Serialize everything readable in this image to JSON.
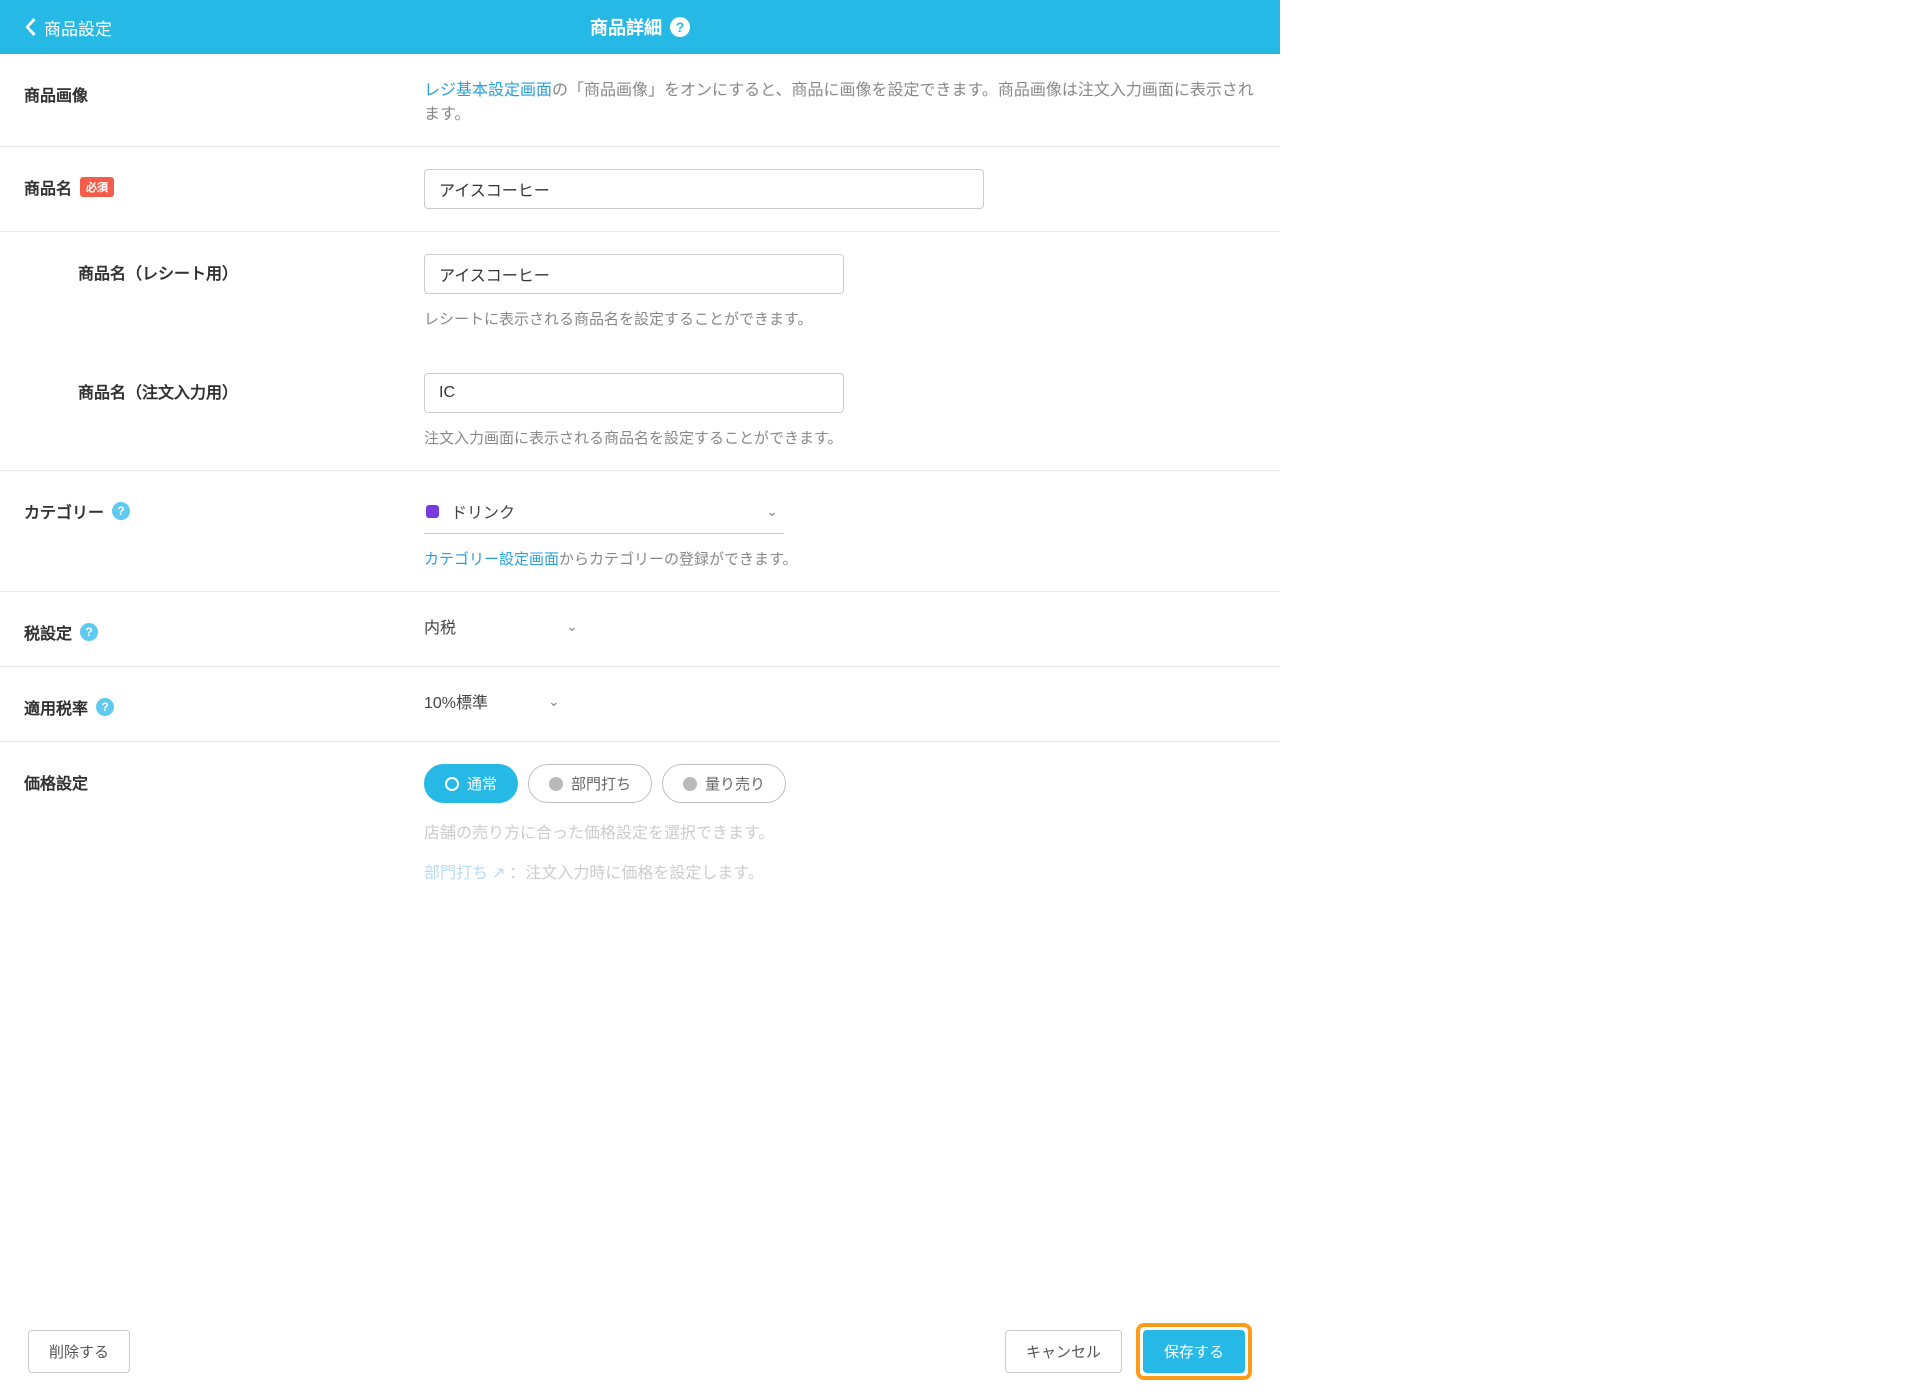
{
  "header": {
    "back_label": "商品設定",
    "title": "商品詳細",
    "help_glyph": "?"
  },
  "image_row": {
    "label": "商品画像",
    "link_text": "レジ基本設定画面",
    "desc_rest": "の「商品画像」をオンにすると、商品に画像を設定できます。商品画像は注文入力画面に表示されます。"
  },
  "name_row": {
    "label": "商品名",
    "required_badge": "必須",
    "value": "アイスコーヒー"
  },
  "receipt_row": {
    "label": "商品名（レシート用）",
    "value": "アイスコーヒー",
    "hint": "レシートに表示される商品名を設定することができます。"
  },
  "order_row": {
    "label": "商品名（注文入力用）",
    "value": "IC",
    "hint": "注文入力画面に表示される商品名を設定することができます。"
  },
  "category_row": {
    "label": "カテゴリー",
    "value": "ドリンク",
    "link_text": "カテゴリー設定画面",
    "desc_rest": "からカテゴリーの登録ができます。"
  },
  "tax_row": {
    "label": "税設定",
    "value": "内税"
  },
  "tax_rate_row": {
    "label": "適用税率",
    "value": "10%標準"
  },
  "price_row": {
    "label": "価格設定",
    "pills": {
      "normal": "通常",
      "dept": "部門打ち",
      "weight": "量り売り"
    },
    "desc1": "店舗の売り方に合った価格設定を選択できます。",
    "desc2_link": "部門打ち",
    "desc2_rest": "：注文入力時に価格を設定します。"
  },
  "footer": {
    "delete": "削除する",
    "cancel": "キャンセル",
    "save": "保存する"
  },
  "glyphs": {
    "chev_down": "⌄",
    "external": "↗"
  }
}
